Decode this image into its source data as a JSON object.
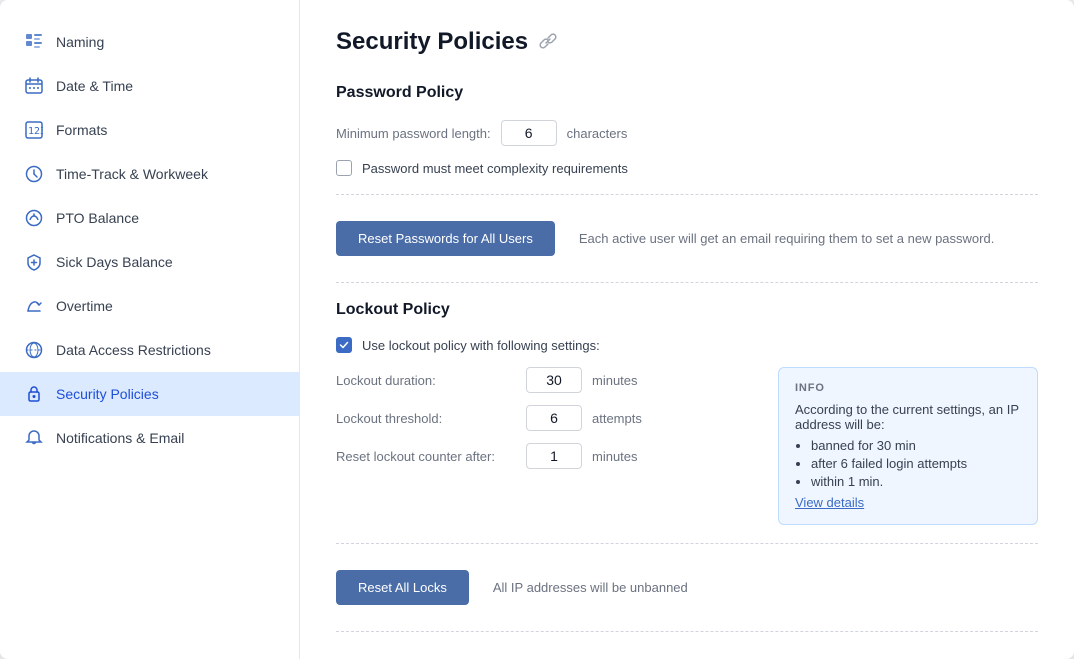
{
  "page": {
    "title": "Security Policies"
  },
  "sidebar": {
    "items": [
      {
        "id": "naming",
        "label": "Naming",
        "icon": "grid-icon",
        "active": false
      },
      {
        "id": "date-time",
        "label": "Date & Time",
        "icon": "calendar-icon",
        "active": false
      },
      {
        "id": "formats",
        "label": "Formats",
        "icon": "format-icon",
        "active": false
      },
      {
        "id": "timetrack",
        "label": "Time-Track & Workweek",
        "icon": "clock-icon",
        "active": false
      },
      {
        "id": "pto-balance",
        "label": "PTO Balance",
        "icon": "pto-icon",
        "active": false
      },
      {
        "id": "sick-days",
        "label": "Sick Days Balance",
        "icon": "shield-small-icon",
        "active": false
      },
      {
        "id": "overtime",
        "label": "Overtime",
        "icon": "overtime-icon",
        "active": false
      },
      {
        "id": "data-access",
        "label": "Data Access Restrictions",
        "icon": "data-icon",
        "active": false
      },
      {
        "id": "security-policies",
        "label": "Security Policies",
        "icon": "security-icon",
        "active": true
      },
      {
        "id": "notifications",
        "label": "Notifications & Email",
        "icon": "bell-icon",
        "active": false
      }
    ]
  },
  "password_policy": {
    "section_title": "Password Policy",
    "min_length_label": "Minimum password length:",
    "min_length_value": "6",
    "min_length_unit": "characters",
    "complexity_label": "Password must meet complexity requirements",
    "reset_button": "Reset Passwords for All Users",
    "reset_description": "Each active user will get an email requiring them to set a new password."
  },
  "lockout_policy": {
    "section_title": "Lockout Policy",
    "use_lockout_label": "Use lockout policy with following settings:",
    "duration_label": "Lockout duration:",
    "duration_value": "30",
    "duration_unit": "minutes",
    "threshold_label": "Lockout threshold:",
    "threshold_value": "6",
    "threshold_unit": "attempts",
    "reset_counter_label": "Reset lockout counter after:",
    "reset_counter_value": "1",
    "reset_counter_unit": "minutes",
    "reset_all_button": "Reset All Locks",
    "reset_all_description": "All IP addresses will be unbanned",
    "info": {
      "label": "INFO",
      "intro": "According to the current settings, an IP address will be:",
      "items": [
        "banned for 30 min",
        "after 6 failed login attempts",
        "within 1 min."
      ],
      "link": "View details"
    }
  }
}
